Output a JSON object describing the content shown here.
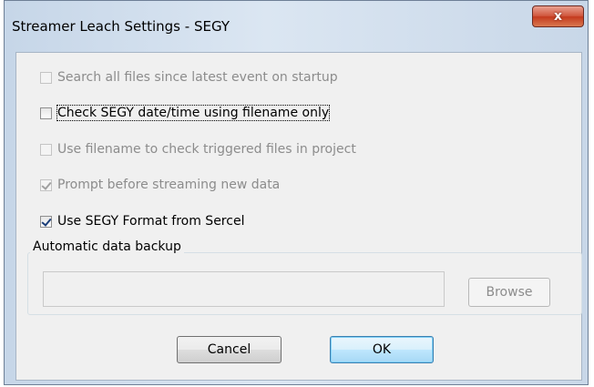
{
  "window": {
    "title": "Streamer Leach Settings - SEGY",
    "close_glyph": "x"
  },
  "options": [
    {
      "label": "Search all files since latest event on startup",
      "checked": false,
      "enabled": false
    },
    {
      "label": "Check SEGY date/time using filename only",
      "checked": false,
      "enabled": true,
      "focused": true
    },
    {
      "label": "Use filename to check triggered files in project",
      "checked": false,
      "enabled": false
    },
    {
      "label": "Prompt before streaming new data",
      "checked": true,
      "enabled": false
    },
    {
      "label": "Use SEGY Format from Sercel",
      "checked": true,
      "enabled": true
    }
  ],
  "backup": {
    "group_title": "Automatic data backup",
    "path_value": "",
    "browse_label": "Browse"
  },
  "buttons": {
    "cancel_label": "Cancel",
    "ok_label": "OK"
  },
  "colors": {
    "title_bar": "#dbe6f2",
    "close_button": "#c43a1e",
    "client_bg": "#f0f0f0",
    "ok_button": "#bee6fd"
  }
}
